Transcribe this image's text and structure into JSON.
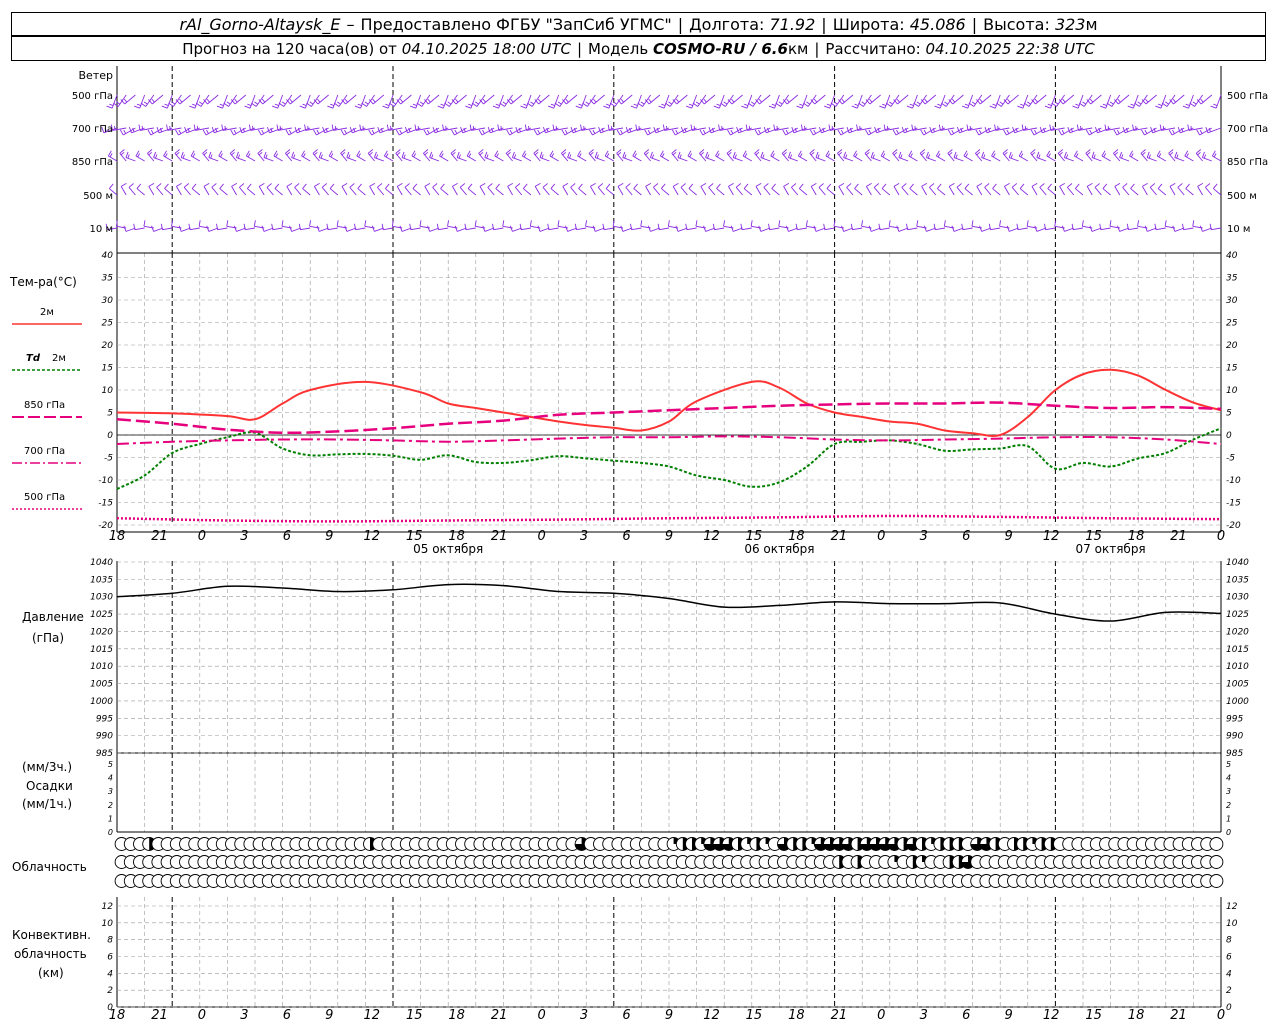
{
  "header": {
    "station": "rAl_Gorno-Altaysk_E",
    "dash": "–",
    "provider": "Предоставлено ФГБУ \"ЗапСиб УГМС\"",
    "lon_label": "Долгота:",
    "lon_value": "71.92",
    "lat_label": "Широта:",
    "lat_value": "45.086",
    "alt_label": "Высота:",
    "alt_value": "323",
    "alt_unit": "м",
    "forecast_label": "Прогноз на 120 часа(ов) от",
    "forecast_from": "04.10.2025 18:00 UTC",
    "model_label": "Модель",
    "model_name": "COSMO-RU / 6.6",
    "model_unit": "км",
    "calc_label": "Рассчитано:",
    "calc_value": "04.10.2025 22:38 UTC"
  },
  "colors": {
    "wind": "#8a2be2",
    "t2m": "#ff3333",
    "td2m": "#008000",
    "t850": "#e6007e",
    "t700": "#e6007e",
    "t500": "#e6007e",
    "pressure": "#000000",
    "grid": "#999999"
  },
  "wind_panel": {
    "title": "Ветер",
    "levels": [
      "500 гПа",
      "700 гПа",
      "850 гПа",
      "500 м",
      "10 м"
    ]
  },
  "temp_panel": {
    "title": "Тем-ра(°C)",
    "legend": [
      {
        "label": "2м",
        "italic_prefix": ""
      },
      {
        "label": "2м",
        "italic_prefix": "Td"
      },
      {
        "label": "850 гПа",
        "italic_prefix": ""
      },
      {
        "label": "700 гПа",
        "italic_prefix": ""
      },
      {
        "label": "500 гПа",
        "italic_prefix": ""
      }
    ]
  },
  "pressure_panel": {
    "title": "Давление",
    "unit": "(гПа)"
  },
  "precip_panel": {
    "unit3": "(мм/3ч.)",
    "title": "Осадки",
    "unit1": "(мм/1ч.)"
  },
  "cloud_panel": {
    "title": "Облачность"
  },
  "conv_panel": {
    "line1": "Конвективн.",
    "line2": "облачность",
    "line3": "(км)"
  },
  "time_axis": {
    "hour_labels": [
      "18",
      "21",
      "0",
      "3",
      "6",
      "9",
      "12",
      "15",
      "18",
      "21",
      "0",
      "3",
      "6",
      "9",
      "12",
      "15",
      "18",
      "21",
      "0",
      "3",
      "6",
      "9",
      "12",
      "15",
      "18",
      "21",
      "0"
    ],
    "date_labels": [
      "05 октября",
      "06 октября",
      "07 октября"
    ]
  },
  "chart_data": [
    {
      "type": "line",
      "title": "Тем-ра(°C)",
      "x_unit": "hours since 04.10.2025 18:00 UTC",
      "ylim": [
        -20,
        40
      ],
      "yticks": [
        -20,
        -15,
        -10,
        -5,
        0,
        5,
        10,
        15,
        20,
        25,
        30,
        35,
        40
      ],
      "grid": true,
      "series": [
        {
          "name": "2м",
          "x": [
            0,
            6,
            12,
            15,
            18,
            21,
            27,
            33,
            36,
            39,
            42,
            45,
            48,
            51,
            54,
            57,
            60,
            63,
            69,
            72,
            75,
            78,
            81,
            84,
            87,
            90,
            93,
            96,
            99,
            102,
            105,
            108,
            111,
            114,
            117,
            120
          ],
          "y": [
            5,
            4.8,
            4.2,
            3.5,
            7,
            10,
            11.8,
            9.5,
            7,
            6,
            5,
            4,
            3,
            2.2,
            1.6,
            1,
            3,
            7.5,
            11.8,
            10.5,
            7,
            5,
            4,
            3,
            2.5,
            1,
            0.4,
            0,
            4,
            10,
            13.5,
            14.5,
            13.2,
            10,
            7.2,
            5.5
          ]
        },
        {
          "name": "Td 2м",
          "x": [
            0,
            3,
            6,
            9,
            12,
            15,
            18,
            21,
            24,
            27,
            30,
            33,
            36,
            39,
            42,
            45,
            48,
            51,
            54,
            57,
            60,
            63,
            66,
            69,
            72,
            75,
            78,
            81,
            84,
            87,
            90,
            93,
            96,
            99,
            102,
            105,
            108,
            111,
            114,
            117,
            120
          ],
          "y": [
            -12,
            -9,
            -4,
            -2,
            -0.5,
            0.5,
            -3,
            -4.5,
            -4.3,
            -4.2,
            -4.6,
            -5.5,
            -4.5,
            -6,
            -6.2,
            -5.6,
            -4.7,
            -5.2,
            -5.7,
            -6.2,
            -7,
            -9,
            -10,
            -11.5,
            -10.5,
            -7,
            -2,
            -1.5,
            -1.2,
            -2,
            -3.5,
            -3.2,
            -3,
            -2.5,
            -7.5,
            -6.2,
            -7,
            -5.2,
            -4,
            -1,
            1.5
          ]
        },
        {
          "name": "850 гПа",
          "x": [
            0,
            6,
            12,
            18,
            24,
            30,
            36,
            42,
            48,
            54,
            60,
            66,
            72,
            78,
            84,
            90,
            96,
            102,
            108,
            114,
            120
          ],
          "y": [
            3.5,
            2.5,
            1.2,
            0.5,
            0.8,
            1.5,
            2.5,
            3.2,
            4.5,
            5,
            5.5,
            6,
            6.5,
            6.8,
            7,
            7,
            7.2,
            6.5,
            6,
            6.2,
            5.8
          ]
        },
        {
          "name": "700 гПа",
          "x": [
            0,
            6,
            12,
            18,
            24,
            30,
            36,
            42,
            48,
            54,
            60,
            66,
            72,
            78,
            84,
            90,
            96,
            102,
            108,
            114,
            120
          ],
          "y": [
            -2,
            -1.5,
            -1.2,
            -1,
            -1,
            -1.2,
            -1.5,
            -1.2,
            -0.8,
            -0.5,
            -0.5,
            -0.3,
            -0.5,
            -1,
            -1.2,
            -1,
            -0.8,
            -0.5,
            -0.5,
            -1,
            -2
          ]
        },
        {
          "name": "500 гПа",
          "x": [
            0,
            12,
            24,
            36,
            48,
            60,
            72,
            84,
            96,
            108,
            120
          ],
          "y": [
            -18.5,
            -19,
            -19.2,
            -19,
            -18.8,
            -18.5,
            -18.3,
            -18,
            -18.2,
            -18.5,
            -18.7
          ]
        }
      ]
    },
    {
      "type": "line",
      "title": "Давление (гПа)",
      "x_unit": "hours since 04.10.2025 18:00 UTC",
      "ylim": [
        985,
        1040
      ],
      "yticks": [
        985,
        990,
        995,
        1000,
        1005,
        1010,
        1015,
        1020,
        1025,
        1030,
        1035,
        1040
      ],
      "grid": true,
      "series": [
        {
          "name": "Давление",
          "x": [
            0,
            6,
            12,
            18,
            24,
            30,
            36,
            42,
            48,
            54,
            60,
            66,
            72,
            78,
            84,
            90,
            96,
            102,
            108,
            114,
            120
          ],
          "y": [
            1030,
            1031,
            1033,
            1032.5,
            1031.5,
            1032,
            1033.5,
            1033.2,
            1031.5,
            1031,
            1029.5,
            1027,
            1027.5,
            1028.5,
            1028,
            1028,
            1028.2,
            1025,
            1023,
            1025.5,
            1025.2
          ]
        }
      ]
    },
    {
      "type": "bar",
      "title": "Осадки",
      "x_unit": "hours since 04.10.2025 18:00 UTC",
      "ylim": [
        0,
        5
      ],
      "yticks": [
        0,
        1,
        2,
        3,
        4,
        5
      ],
      "values": []
    },
    {
      "type": "heatmap",
      "title": "Облачность",
      "rows": [
        "upper",
        "middle",
        "lower"
      ],
      "x_unit": "hours since 04.10.2025 18:00 UTC",
      "x_step_hours": 1,
      "cloud_cover_fraction": {
        "upper": {
          "3": 0.5,
          "27": 0.5,
          "50": 0.75,
          "60": 0.25,
          "61": 0.5,
          "62": 0.5,
          "63": 0.25,
          "64": 0.75,
          "65": 0.75,
          "66": 0.75,
          "67": 0.5,
          "68": 0.25,
          "69": 0.5,
          "70": 0.25,
          "72": 0.75,
          "73": 0.5,
          "74": 0.5,
          "75": 0.25,
          "76": 0.75,
          "77": 0.75,
          "78": 0.75,
          "79": 0.75,
          "80": 0.5,
          "81": 0.75,
          "82": 0.75,
          "83": 0.75,
          "84": 0.75,
          "85": 0.5,
          "86": 0.75,
          "87": 0.5,
          "88": 0.25,
          "89": 0.5,
          "90": 0.5,
          "91": 0.5,
          "93": 0.75,
          "94": 0.75,
          "95": 0.5,
          "97": 0.5,
          "98": 0.5,
          "99": 0.25,
          "100": 0.5,
          "101": 0.5
        },
        "middle": {
          "78": 0.5,
          "80": 0.5,
          "84": 0.25,
          "86": 0.5,
          "87": 0.25,
          "90": 0.5,
          "91": 0.5,
          "92": 0.75
        },
        "lower": {}
      }
    },
    {
      "type": "bar",
      "title": "Конвективн. облачность (км)",
      "x_unit": "hours since 04.10.2025 18:00 UTC",
      "ylim": [
        0,
        12
      ],
      "yticks": [
        0,
        2,
        4,
        6,
        8,
        10,
        12
      ],
      "values": []
    }
  ]
}
